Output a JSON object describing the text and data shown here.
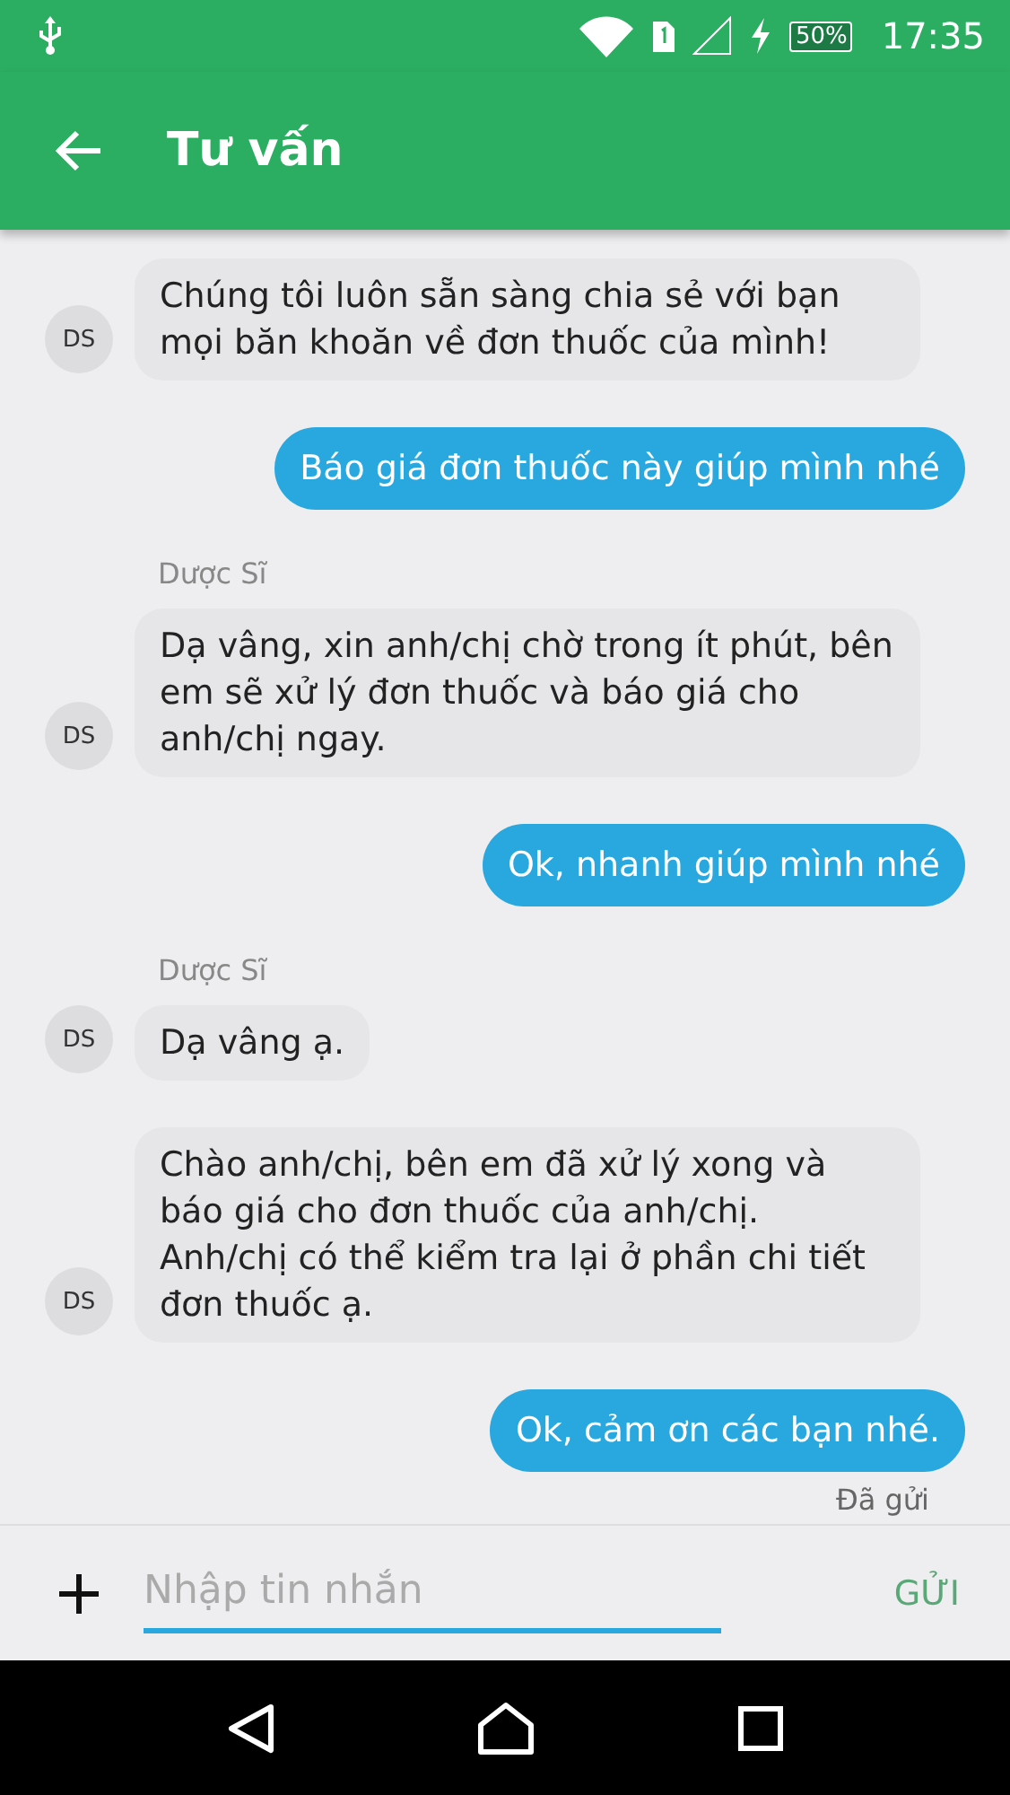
{
  "status_bar": {
    "battery": "50%",
    "time": "17:35"
  },
  "app_bar": {
    "title": "Tư vấn"
  },
  "messages": [
    {
      "kind": "received",
      "text": "Chúng tôi luôn sẵn sàng chia sẻ với bạn mọi băn khoăn về đơn thuốc của mình!",
      "avatar": "DS"
    },
    {
      "kind": "sent",
      "text": "Báo giá đơn thuốc này giúp mình nhé"
    },
    {
      "kind": "received",
      "sender": "Dược Sĩ",
      "text": "Dạ vâng, xin anh/chị chờ trong ít phút, bên em sẽ xử lý đơn thuốc và báo giá cho anh/chị ngay.",
      "avatar": "DS"
    },
    {
      "kind": "sent",
      "text": "Ok, nhanh giúp mình nhé"
    },
    {
      "kind": "received",
      "sender": "Dược Sĩ",
      "text": "Dạ vâng ạ.",
      "avatar": "DS"
    },
    {
      "kind": "received",
      "text": "Chào anh/chị, bên em đã xử lý xong và báo giá cho đơn thuốc của anh/chị. Anh/chị có thể kiểm tra lại ở phần chi tiết đơn thuốc ạ.",
      "avatar": "DS"
    },
    {
      "kind": "sent",
      "text": "Ok, cảm ơn các bạn nhé.",
      "status": "Đã gửi"
    }
  ],
  "composer": {
    "placeholder": "Nhập tin nhắn",
    "send_label": "GỬI",
    "send_disabled": true
  }
}
